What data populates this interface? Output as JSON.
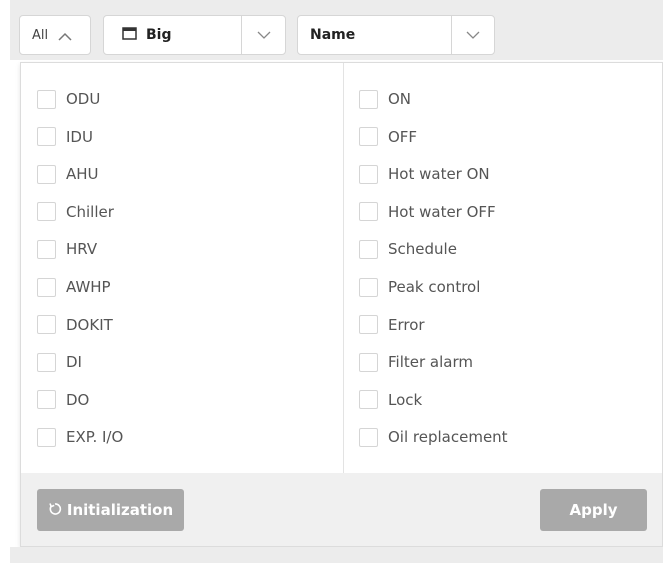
{
  "toolbar": {
    "all_label": "All",
    "size_select": {
      "value": "Big"
    },
    "sort_select": {
      "value": "Name"
    }
  },
  "filters": {
    "device_types": [
      "ODU",
      "IDU",
      "AHU",
      "Chiller",
      "HRV",
      "AWHP",
      "DOKIT",
      "DI",
      "DO",
      "EXP. I/O"
    ],
    "statuses": [
      "ON",
      "OFF",
      "Hot water ON",
      "Hot water OFF",
      "Schedule",
      "Peak control",
      "Error",
      "Filter alarm",
      "Lock",
      "Oil replacement"
    ]
  },
  "footer": {
    "initialization_label": "Initialization",
    "apply_label": "Apply"
  },
  "colors": {
    "toolbar_bg": "#ececec",
    "button_bg": "#a9a9a9",
    "footer_bg": "#f0f0f0"
  },
  "icons": [
    "chevron-up-icon",
    "window-icon",
    "chevron-down-icon",
    "refresh-icon"
  ]
}
